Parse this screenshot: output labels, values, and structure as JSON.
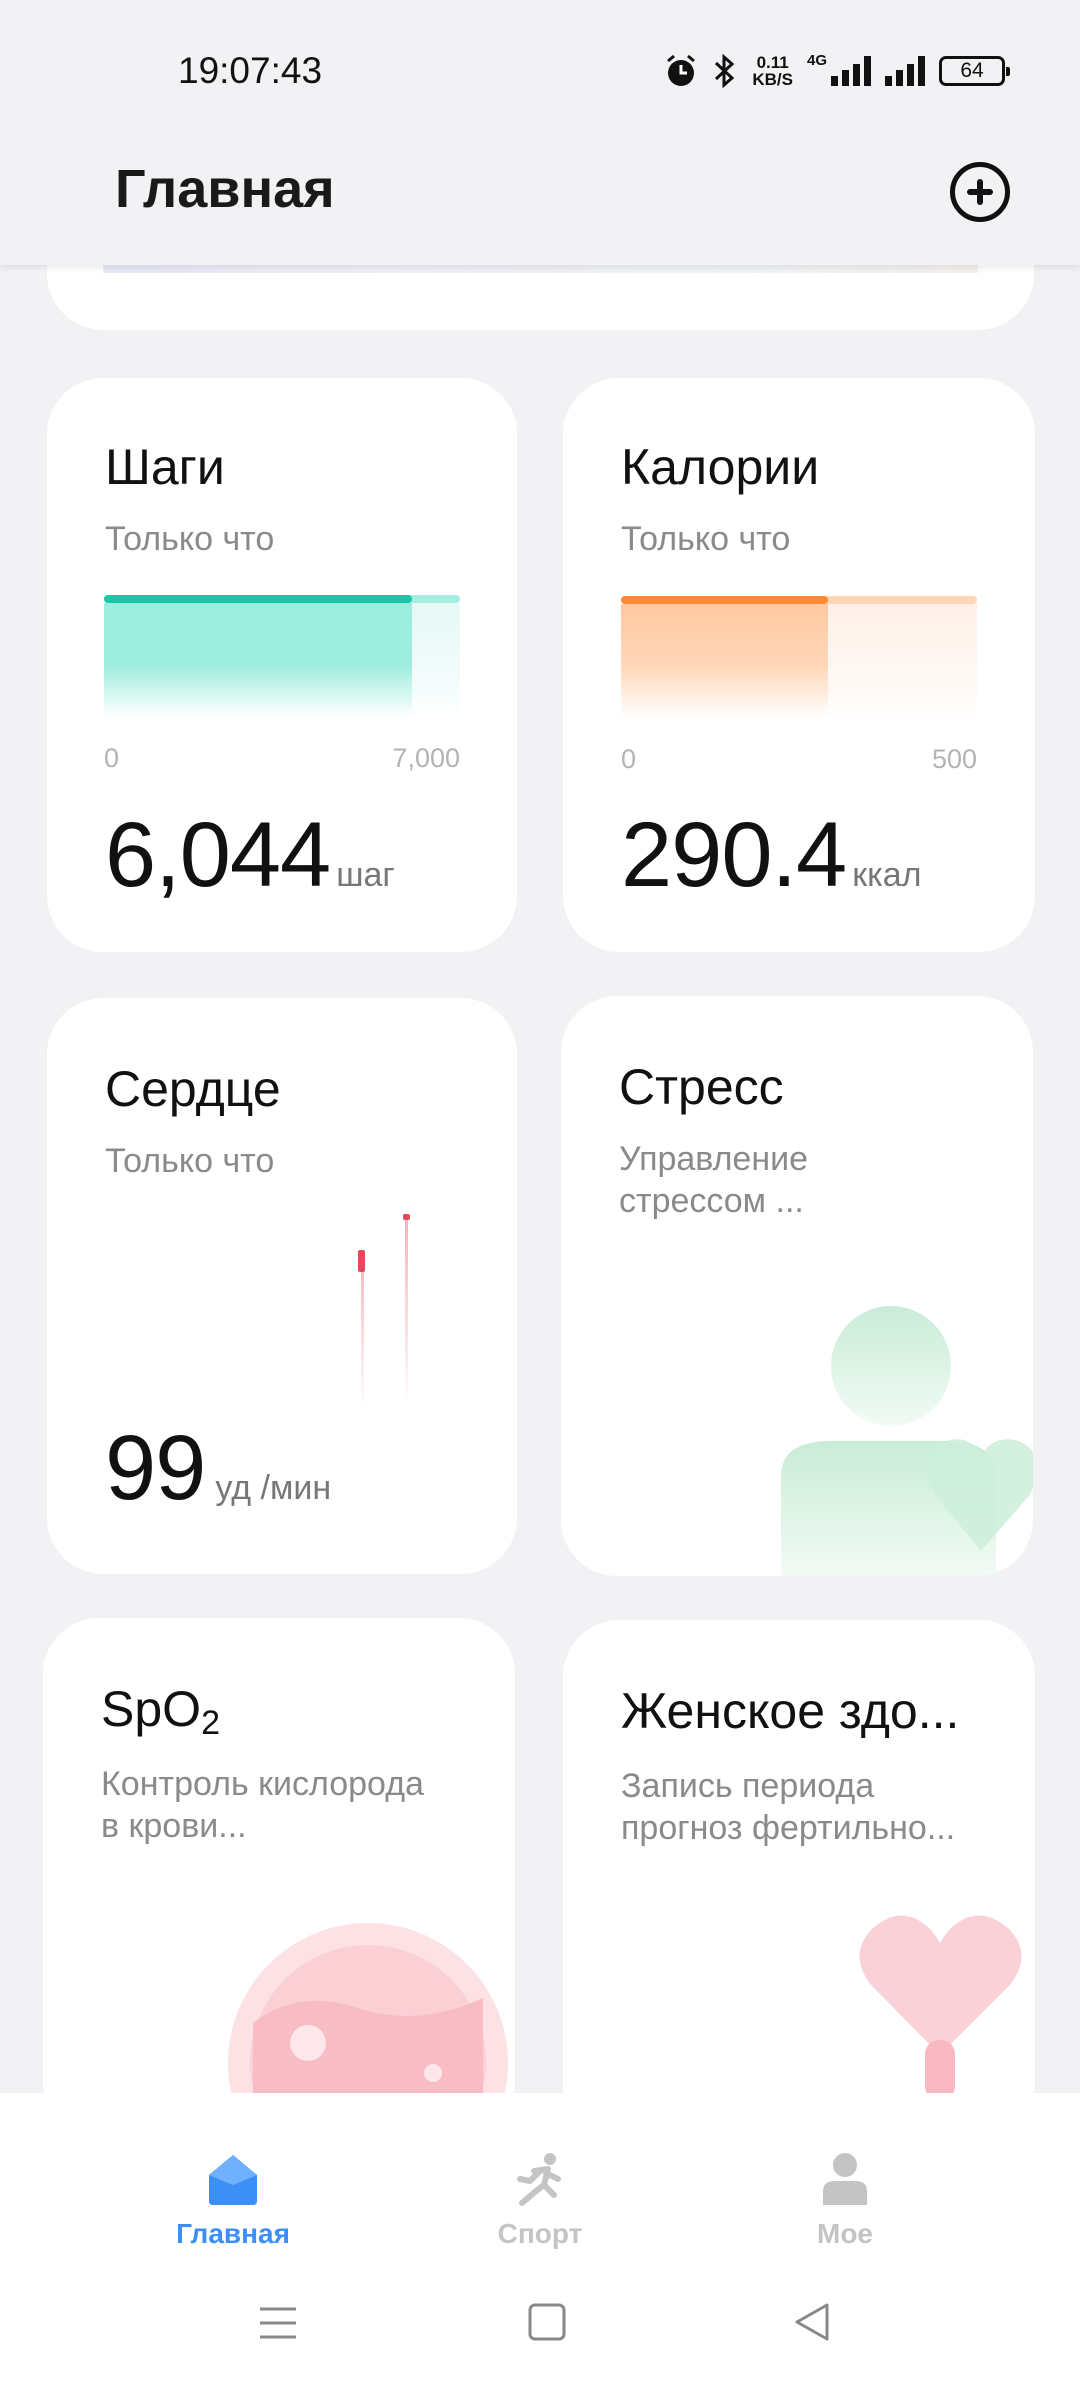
{
  "status_bar": {
    "time": "19:07:43",
    "net_speed_value": "0.11",
    "net_speed_unit": "KB/S",
    "network_type": "4G",
    "battery": "64"
  },
  "header": {
    "title": "Главная"
  },
  "cards": {
    "steps": {
      "title": "Шаги",
      "subtitle": "Только что",
      "axis_min": "0",
      "axis_max": "7,000",
      "value": "6,044",
      "unit": "шаг",
      "progress": 0.864,
      "color": "#15c9a6"
    },
    "calories": {
      "title": "Калории",
      "subtitle": "Только что",
      "axis_min": "0",
      "axis_max": "500",
      "value": "290.4",
      "unit": "ккал",
      "progress": 0.581,
      "color": "#ff8a34"
    },
    "heart": {
      "title": "Сердце",
      "subtitle": "Только что",
      "value": "99",
      "unit": "уд /мин"
    },
    "stress": {
      "title": "Стресс",
      "subtitle_line1": "Управление",
      "subtitle_line2": "стрессом ..."
    },
    "spo2": {
      "title_main": "SpO",
      "title_sub": "2",
      "subtitle_line1": "Контроль кислорода",
      "subtitle_line2": "в крови..."
    },
    "women": {
      "title": "Женское здо...",
      "subtitle_line1": "Запись периода",
      "subtitle_line2": "прогноз фертильно..."
    }
  },
  "bottom_nav": {
    "items": [
      {
        "label": "Главная",
        "active": true,
        "icon": "home-icon"
      },
      {
        "label": "Спорт",
        "active": false,
        "icon": "running-icon"
      },
      {
        "label": "Мое",
        "active": false,
        "icon": "profile-icon"
      }
    ],
    "active_color": "#3d8ff5",
    "inactive_color": "#c4c4c4"
  }
}
